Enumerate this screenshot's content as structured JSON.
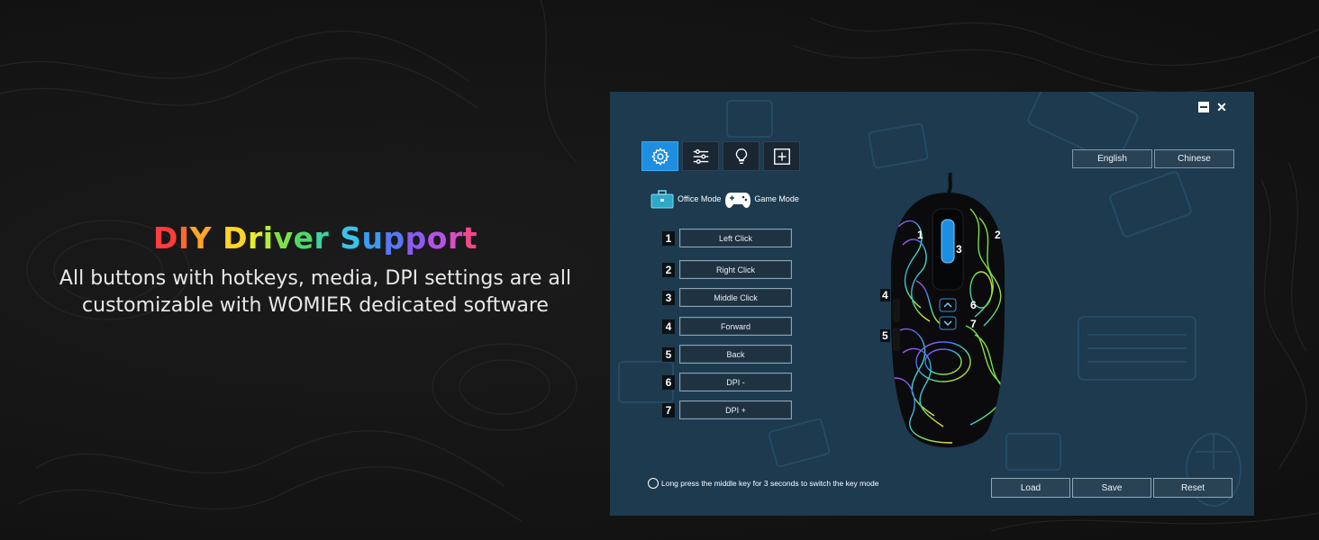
{
  "promo": {
    "title_letters": [
      {
        "ch": "D",
        "color": "#ff3b3b"
      },
      {
        "ch": "I",
        "color": "#ff6a2a"
      },
      {
        "ch": "Y",
        "color": "#ffa52a"
      },
      {
        "ch": " ",
        "color": "#ffffff"
      },
      {
        "ch": "D",
        "color": "#ffd42a"
      },
      {
        "ch": "r",
        "color": "#e5ec2a"
      },
      {
        "ch": "i",
        "color": "#b7ec3a"
      },
      {
        "ch": "v",
        "color": "#7fe04a"
      },
      {
        "ch": "e",
        "color": "#4fd86a"
      },
      {
        "ch": "r",
        "color": "#3dd3a0"
      },
      {
        "ch": " ",
        "color": "#ffffff"
      },
      {
        "ch": "S",
        "color": "#3ac3e8"
      },
      {
        "ch": "u",
        "color": "#3a9bf0"
      },
      {
        "ch": "p",
        "color": "#5878f5"
      },
      {
        "ch": "p",
        "color": "#8a5cf0"
      },
      {
        "ch": "o",
        "color": "#b352e8"
      },
      {
        "ch": "r",
        "color": "#d94cc8"
      },
      {
        "ch": "t",
        "color": "#ef4a8a"
      }
    ],
    "desc_line1": "All buttons with hotkeys, media, DPI settings are all",
    "desc_line2": "customizable with WOMIER dedicated software"
  },
  "app": {
    "accent": "#1e8fe0",
    "toolbar": [
      {
        "icon": "gear-icon"
      },
      {
        "icon": "sliders-icon"
      },
      {
        "icon": "lightbulb-icon"
      },
      {
        "icon": "plus-box-icon"
      }
    ],
    "modes": {
      "office": "Office Mode",
      "game": "Game Mode"
    },
    "key_buttons": [
      {
        "num": "1",
        "label": "Left Click"
      },
      {
        "num": "2",
        "label": "Right Click"
      },
      {
        "num": "3",
        "label": "Middle Click"
      },
      {
        "num": "4",
        "label": "Forward"
      },
      {
        "num": "5",
        "label": "Back"
      },
      {
        "num": "6",
        "label": "DPI -"
      },
      {
        "num": "7",
        "label": "DPI +"
      }
    ],
    "lang": {
      "english": "English",
      "chinese": "Chinese"
    },
    "mouse_labels": {
      "b1": "1",
      "b2": "2",
      "b3": "3",
      "b4": "4",
      "b5": "5",
      "b6": "6",
      "b7": "7"
    },
    "hint": "Long press the middle key for 3 seconds  to switch the key mode",
    "bottom": {
      "load": "Load",
      "save": "Save",
      "reset": "Reset"
    },
    "close_glyph": "✕"
  }
}
